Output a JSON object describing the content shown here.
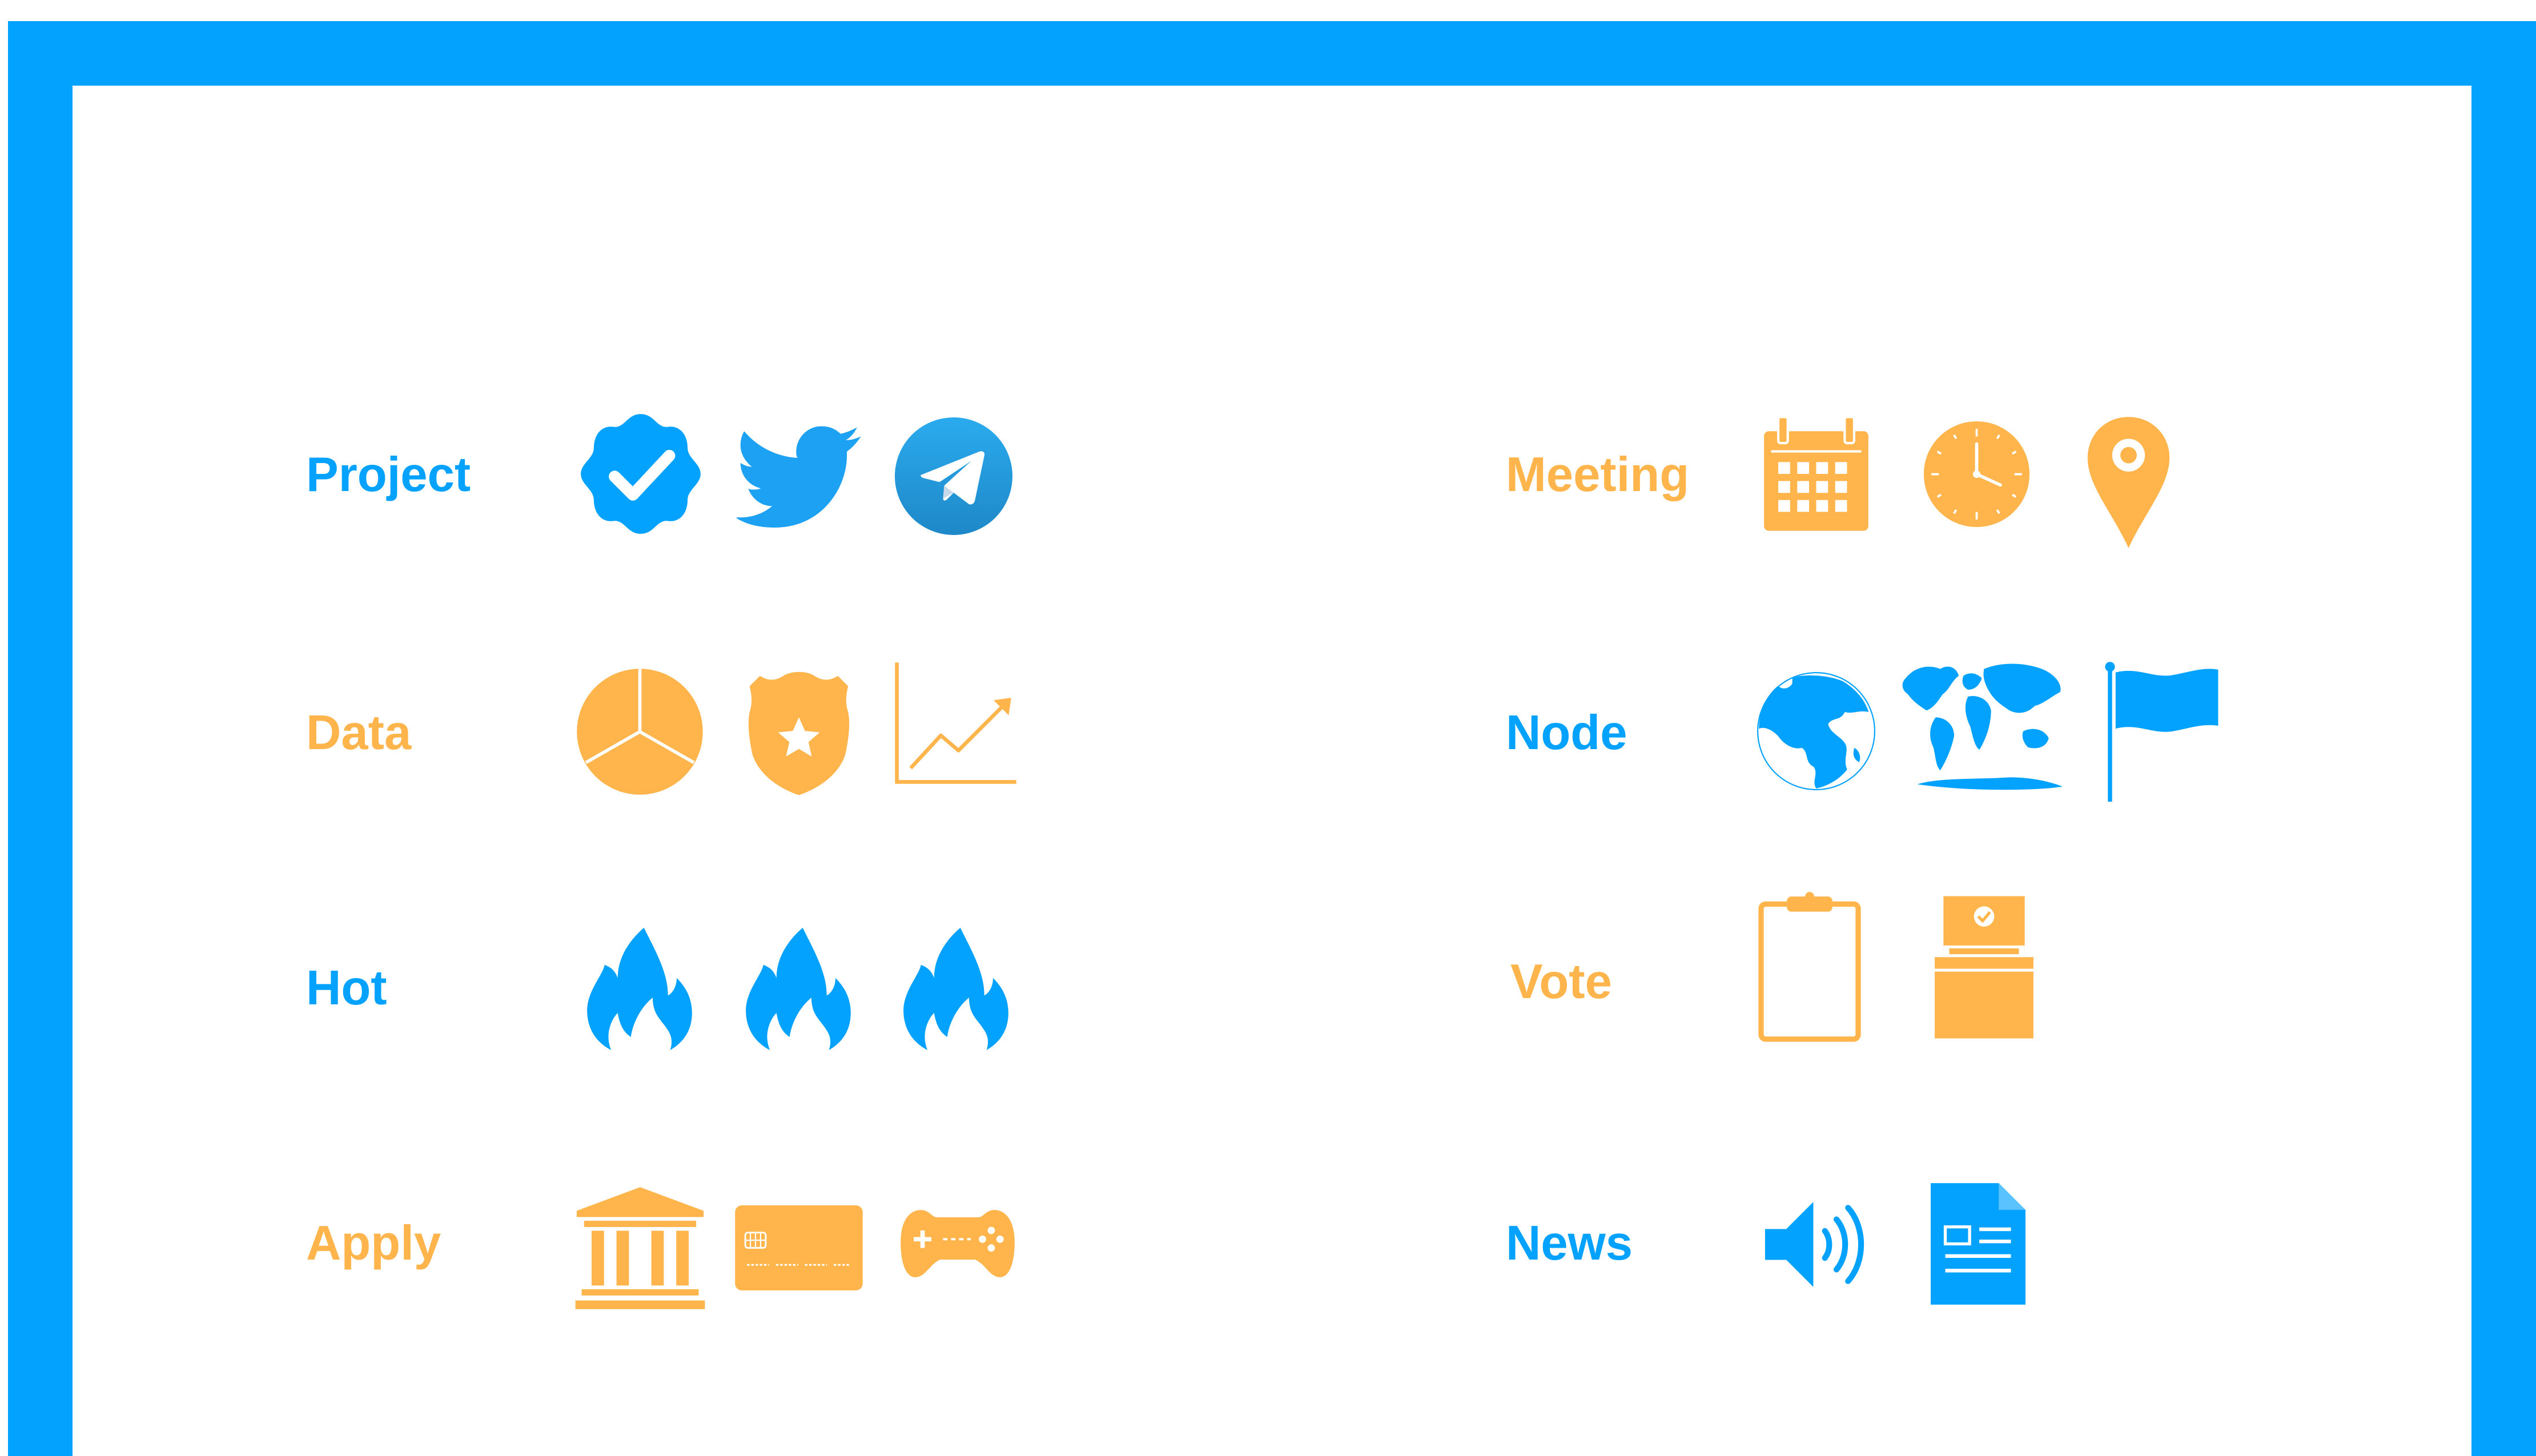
{
  "colors": {
    "blue": "#03a2fe",
    "orange": "#ffb54c",
    "white": "#ffffff"
  },
  "categories": [
    {
      "key": "project",
      "label": "Project",
      "color": "blue",
      "icons": [
        "verified-badge-icon",
        "twitter-bird-icon",
        "telegram-icon"
      ]
    },
    {
      "key": "data",
      "label": "Data",
      "color": "orange",
      "icons": [
        "pie-chart-icon",
        "police-badge-icon",
        "line-chart-icon"
      ]
    },
    {
      "key": "hot",
      "label": "Hot",
      "color": "blue",
      "icons": [
        "flame-icon",
        "flame-icon",
        "flame-icon"
      ]
    },
    {
      "key": "apply",
      "label": "Apply",
      "color": "orange",
      "icons": [
        "bank-building-icon",
        "credit-card-icon",
        "gamepad-icon"
      ]
    },
    {
      "key": "meeting",
      "label": "Meeting",
      "color": "orange",
      "icons": [
        "calendar-icon",
        "clock-icon",
        "map-pin-icon"
      ]
    },
    {
      "key": "node",
      "label": "Node",
      "color": "blue",
      "icons": [
        "globe-icon",
        "world-map-icon",
        "flag-icon"
      ]
    },
    {
      "key": "vote",
      "label": "Vote",
      "color": "orange",
      "icons": [
        "clipboard-icon",
        "ballot-box-icon"
      ]
    },
    {
      "key": "news",
      "label": "News",
      "color": "blue",
      "icons": [
        "speaker-icon",
        "document-icon"
      ]
    }
  ]
}
